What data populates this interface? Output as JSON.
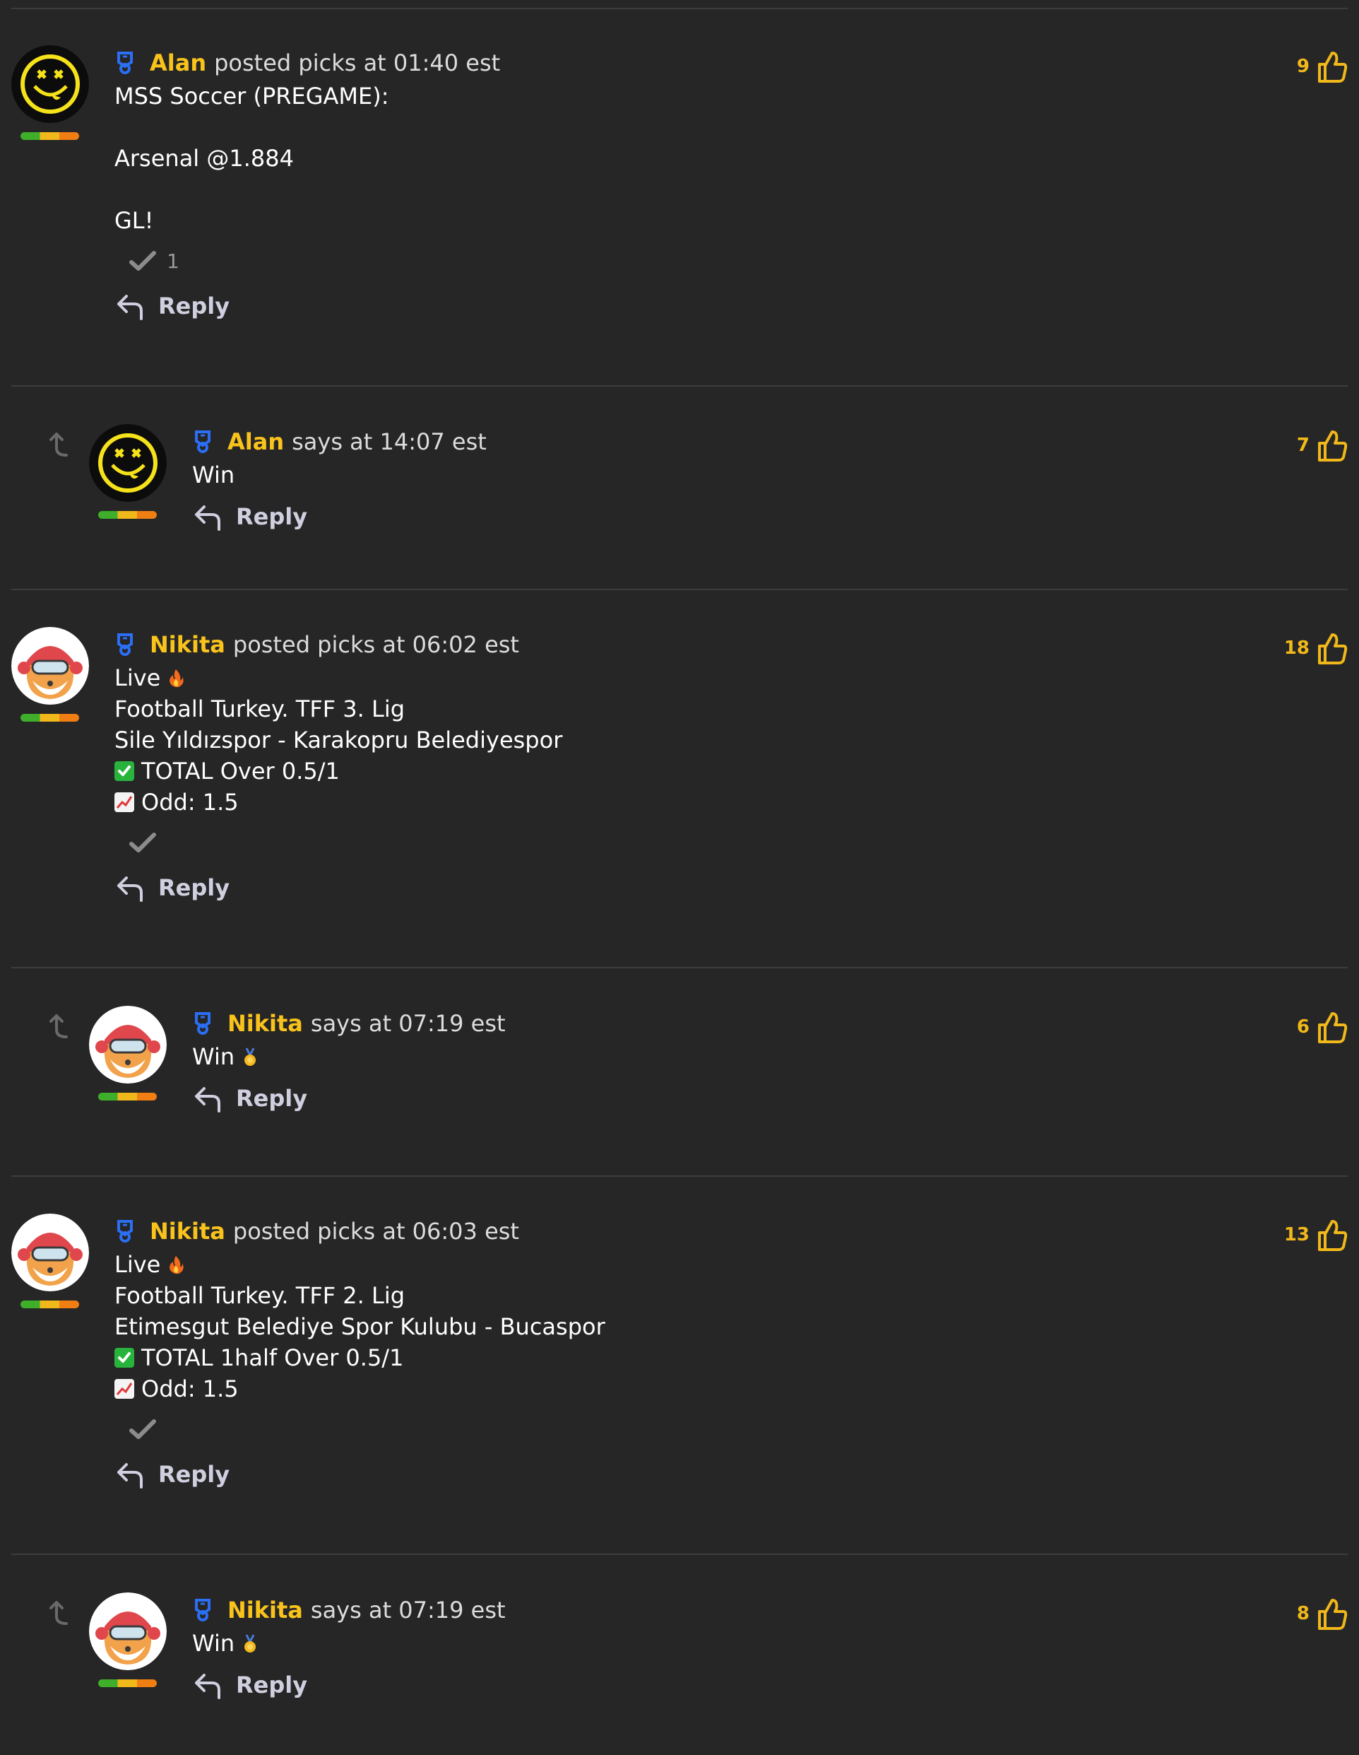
{
  "colors": {
    "background": "#262626",
    "divider": "#3d3d3d",
    "username": "#f9c31c",
    "like_count": "#f0b81a",
    "badge": "#2a6ff5",
    "reply": "#cfcfdf"
  },
  "comments": [
    {
      "username": "Alan",
      "meta": "posted picks at 01:40 est",
      "lines": [
        "MSS Soccer (PREGAME):",
        "",
        "Arsenal @1.884",
        "",
        "GL!"
      ],
      "reaction_count": "1",
      "reply_label": "Reply",
      "likes": "9",
      "avatar": "smiley-icon"
    },
    {
      "username": "Alan",
      "meta": "says at 14:07 est",
      "lines": [
        "Win"
      ],
      "reply_label": "Reply",
      "likes": "7",
      "avatar": "smiley-icon"
    },
    {
      "username": "Nikita",
      "meta": "posted picks at 06:02 est",
      "lines": [
        "Live",
        "Football Turkey. TFF 3. Lig",
        "Sile Yıldızspor - Karakopru Belediyespor",
        "TOTAL Over 0.5/1",
        "Odd: 1.5"
      ],
      "reaction_count": "",
      "reply_label": "Reply",
      "likes": "18",
      "avatar": "shiba-icon"
    },
    {
      "username": "Nikita",
      "meta": "says at 07:19 est",
      "lines": [
        "Win"
      ],
      "reply_label": "Reply",
      "likes": "6",
      "avatar": "shiba-icon"
    },
    {
      "username": "Nikita",
      "meta": "posted picks at 06:03 est",
      "lines": [
        "Live",
        "Football Turkey. TFF 2. Lig",
        "Etimesgut Belediye Spor Kulubu - Bucaspor",
        "TOTAL 1half Over 0.5/1",
        "Odd: 1.5"
      ],
      "reaction_count": "",
      "reply_label": "Reply",
      "likes": "13",
      "avatar": "shiba-icon"
    },
    {
      "username": "Nikita",
      "meta": "says at 07:19 est",
      "lines": [
        "Win"
      ],
      "reply_label": "Reply",
      "likes": "8",
      "avatar": "shiba-icon"
    }
  ]
}
